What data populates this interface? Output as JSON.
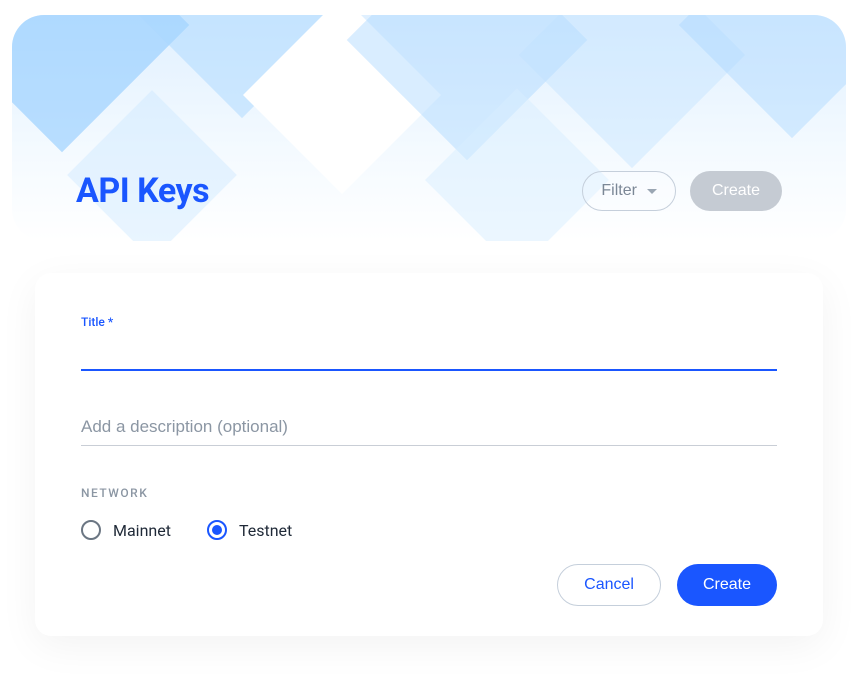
{
  "hero": {
    "title": "API Keys",
    "filter_label": "Filter",
    "create_label": "Create"
  },
  "form": {
    "title_label": "Title *",
    "title_value": "",
    "description_placeholder": "Add a description (optional)",
    "description_value": "",
    "network_section_label": "NETWORK",
    "network_options": {
      "mainnet": "Mainnet",
      "testnet": "Testnet"
    },
    "network_selected": "testnet",
    "cancel_label": "Cancel",
    "create_label": "Create"
  }
}
